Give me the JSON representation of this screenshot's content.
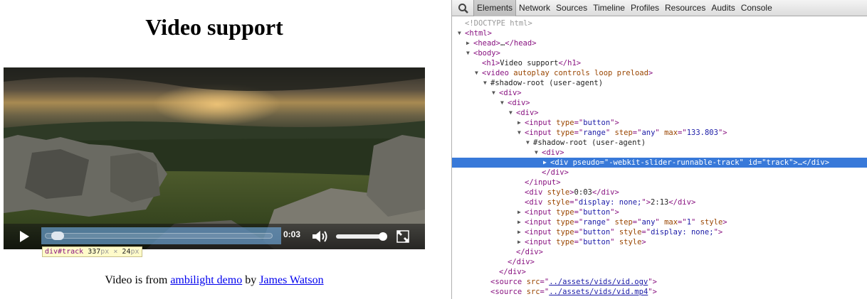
{
  "page": {
    "title": "Video support",
    "credit": {
      "prefix": "Video is from ",
      "link1": "ambilight demo",
      "middle": " by ",
      "link2": "James Watson"
    }
  },
  "video": {
    "current_time": "0:03",
    "duration": "2:13",
    "progress_fraction": 0.023,
    "volume_fraction": 1.0,
    "controls": [
      "play-icon",
      "volume-icon",
      "fullscreen-icon"
    ]
  },
  "tooltip": {
    "tag": "div#track",
    "width": "337",
    "height": "24",
    "unit": "px",
    "times": "×"
  },
  "devtools": {
    "tabs": [
      "Elements",
      "Network",
      "Sources",
      "Timeline",
      "Profiles",
      "Resources",
      "Audits",
      "Console"
    ],
    "active_tab": "Elements",
    "selection_color": "#3879d9",
    "nodes": [
      {
        "indent": 0,
        "arrow": "",
        "parts": [
          {
            "c": "doctype",
            "s": "<!DOCTYPE html>"
          }
        ]
      },
      {
        "indent": 0,
        "arrow": "▼",
        "parts": [
          {
            "c": "t",
            "s": "<html>"
          }
        ]
      },
      {
        "indent": 1,
        "arrow": "▶",
        "parts": [
          {
            "c": "t",
            "s": "<head>"
          },
          {
            "c": "x",
            "s": "…"
          },
          {
            "c": "t",
            "s": "</head>"
          }
        ]
      },
      {
        "indent": 1,
        "arrow": "▼",
        "parts": [
          {
            "c": "t",
            "s": "<body>"
          }
        ]
      },
      {
        "indent": 2,
        "arrow": "",
        "parts": [
          {
            "c": "t",
            "s": "<h1>"
          },
          {
            "c": "x",
            "s": "Video support"
          },
          {
            "c": "t",
            "s": "</h1>"
          }
        ]
      },
      {
        "indent": 2,
        "arrow": "▼",
        "parts": [
          {
            "c": "t",
            "s": "<video "
          },
          {
            "c": "a",
            "s": "autoplay controls loop preload"
          },
          {
            "c": "t",
            "s": ">"
          }
        ]
      },
      {
        "indent": 3,
        "arrow": "▼",
        "parts": [
          {
            "c": "x",
            "s": "#shadow-root (user-agent)"
          }
        ]
      },
      {
        "indent": 4,
        "arrow": "▼",
        "parts": [
          {
            "c": "t",
            "s": "<div>"
          }
        ]
      },
      {
        "indent": 5,
        "arrow": "▼",
        "parts": [
          {
            "c": "t",
            "s": "<div>"
          }
        ]
      },
      {
        "indent": 6,
        "arrow": "▼",
        "parts": [
          {
            "c": "t",
            "s": "<div>"
          }
        ]
      },
      {
        "indent": 7,
        "arrow": "▶",
        "parts": [
          {
            "c": "t",
            "s": "<input "
          },
          {
            "c": "a",
            "s": "type"
          },
          {
            "c": "t",
            "s": "=\""
          },
          {
            "c": "v",
            "s": "button"
          },
          {
            "c": "t",
            "s": "\">"
          }
        ]
      },
      {
        "indent": 7,
        "arrow": "▼",
        "parts": [
          {
            "c": "t",
            "s": "<input "
          },
          {
            "c": "a",
            "s": "type"
          },
          {
            "c": "t",
            "s": "=\""
          },
          {
            "c": "v",
            "s": "range"
          },
          {
            "c": "t",
            "s": "\" "
          },
          {
            "c": "a",
            "s": "step"
          },
          {
            "c": "t",
            "s": "=\""
          },
          {
            "c": "v",
            "s": "any"
          },
          {
            "c": "t",
            "s": "\" "
          },
          {
            "c": "a",
            "s": "max"
          },
          {
            "c": "t",
            "s": "=\""
          },
          {
            "c": "v",
            "s": "133.803"
          },
          {
            "c": "t",
            "s": "\">"
          }
        ]
      },
      {
        "indent": 8,
        "arrow": "▼",
        "parts": [
          {
            "c": "x",
            "s": "#shadow-root (user-agent)"
          }
        ]
      },
      {
        "indent": 9,
        "arrow": "▼",
        "parts": [
          {
            "c": "t",
            "s": "<div>"
          }
        ]
      },
      {
        "indent": 10,
        "arrow": "▶",
        "selected": true,
        "parts": [
          {
            "c": "t",
            "s": "<div "
          },
          {
            "c": "a",
            "s": "pseudo"
          },
          {
            "c": "t",
            "s": "=\""
          },
          {
            "c": "v",
            "s": "-webkit-slider-runnable-track"
          },
          {
            "c": "t",
            "s": "\" "
          },
          {
            "c": "a",
            "s": "id"
          },
          {
            "c": "t",
            "s": "=\""
          },
          {
            "c": "v",
            "s": "track"
          },
          {
            "c": "t",
            "s": "\">"
          },
          {
            "c": "x",
            "s": "…"
          },
          {
            "c": "t",
            "s": "</div>"
          }
        ]
      },
      {
        "indent": 9,
        "arrow": "",
        "parts": [
          {
            "c": "t",
            "s": "</div>"
          }
        ]
      },
      {
        "indent": 7,
        "arrow": "",
        "parts": [
          {
            "c": "t",
            "s": "</input>"
          }
        ]
      },
      {
        "indent": 7,
        "arrow": "",
        "parts": [
          {
            "c": "t",
            "s": "<div "
          },
          {
            "c": "a",
            "s": "style"
          },
          {
            "c": "t",
            "s": ">"
          },
          {
            "c": "x",
            "s": "0:03"
          },
          {
            "c": "t",
            "s": "</div>"
          }
        ]
      },
      {
        "indent": 7,
        "arrow": "",
        "parts": [
          {
            "c": "t",
            "s": "<div "
          },
          {
            "c": "a",
            "s": "style"
          },
          {
            "c": "t",
            "s": "=\""
          },
          {
            "c": "v",
            "s": "display: none;"
          },
          {
            "c": "t",
            "s": "\">"
          },
          {
            "c": "x",
            "s": "2:13"
          },
          {
            "c": "t",
            "s": "</div>"
          }
        ]
      },
      {
        "indent": 7,
        "arrow": "▶",
        "parts": [
          {
            "c": "t",
            "s": "<input "
          },
          {
            "c": "a",
            "s": "type"
          },
          {
            "c": "t",
            "s": "=\""
          },
          {
            "c": "v",
            "s": "button"
          },
          {
            "c": "t",
            "s": "\">"
          }
        ]
      },
      {
        "indent": 7,
        "arrow": "▶",
        "parts": [
          {
            "c": "t",
            "s": "<input "
          },
          {
            "c": "a",
            "s": "type"
          },
          {
            "c": "t",
            "s": "=\""
          },
          {
            "c": "v",
            "s": "range"
          },
          {
            "c": "t",
            "s": "\" "
          },
          {
            "c": "a",
            "s": "step"
          },
          {
            "c": "t",
            "s": "=\""
          },
          {
            "c": "v",
            "s": "any"
          },
          {
            "c": "t",
            "s": "\" "
          },
          {
            "c": "a",
            "s": "max"
          },
          {
            "c": "t",
            "s": "=\""
          },
          {
            "c": "v",
            "s": "1"
          },
          {
            "c": "t",
            "s": "\" "
          },
          {
            "c": "a",
            "s": "style"
          },
          {
            "c": "t",
            "s": ">"
          }
        ]
      },
      {
        "indent": 7,
        "arrow": "▶",
        "parts": [
          {
            "c": "t",
            "s": "<input "
          },
          {
            "c": "a",
            "s": "type"
          },
          {
            "c": "t",
            "s": "=\""
          },
          {
            "c": "v",
            "s": "button"
          },
          {
            "c": "t",
            "s": "\" "
          },
          {
            "c": "a",
            "s": "style"
          },
          {
            "c": "t",
            "s": "=\""
          },
          {
            "c": "v",
            "s": "display: none;"
          },
          {
            "c": "t",
            "s": "\">"
          }
        ]
      },
      {
        "indent": 7,
        "arrow": "▶",
        "parts": [
          {
            "c": "t",
            "s": "<input "
          },
          {
            "c": "a",
            "s": "type"
          },
          {
            "c": "t",
            "s": "=\""
          },
          {
            "c": "v",
            "s": "button"
          },
          {
            "c": "t",
            "s": "\" "
          },
          {
            "c": "a",
            "s": "style"
          },
          {
            "c": "t",
            "s": ">"
          }
        ]
      },
      {
        "indent": 6,
        "arrow": "",
        "parts": [
          {
            "c": "t",
            "s": "</div>"
          }
        ]
      },
      {
        "indent": 5,
        "arrow": "",
        "parts": [
          {
            "c": "t",
            "s": "</div>"
          }
        ]
      },
      {
        "indent": 4,
        "arrow": "",
        "parts": [
          {
            "c": "t",
            "s": "</div>"
          }
        ]
      },
      {
        "indent": 3,
        "arrow": "",
        "parts": [
          {
            "c": "t",
            "s": "<source "
          },
          {
            "c": "a",
            "s": "src"
          },
          {
            "c": "t",
            "s": "=\""
          },
          {
            "c": "lnk",
            "s": "../assets/vids/vid.ogv"
          },
          {
            "c": "t",
            "s": "\">"
          }
        ]
      },
      {
        "indent": 3,
        "arrow": "",
        "parts": [
          {
            "c": "t",
            "s": "<source "
          },
          {
            "c": "a",
            "s": "src"
          },
          {
            "c": "t",
            "s": "=\""
          },
          {
            "c": "lnk",
            "s": "../assets/vids/vid.mp4"
          },
          {
            "c": "t",
            "s": "\">"
          }
        ]
      }
    ]
  }
}
